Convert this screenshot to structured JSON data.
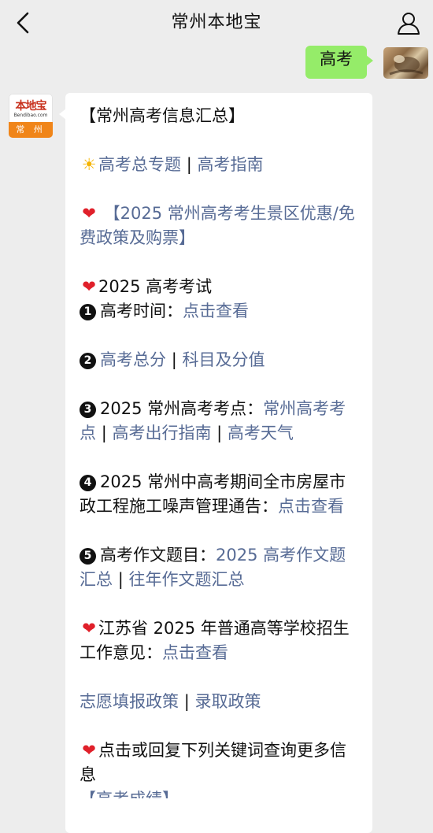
{
  "header": {
    "title": "常州本地宝"
  },
  "outgoing": {
    "text": "高考"
  },
  "logo": {
    "main": "本地宝",
    "sub": "Bendibao.com",
    "city": "常 州"
  },
  "message": {
    "heading": "【常州高考信息汇总】",
    "topic_link": "高考总专题",
    "guide_link": "高考指南",
    "scenic_link": "【2025 常州高考考生景区优惠/免费政策及购票】",
    "exam_heading": "2025 高考考试",
    "item1_label": "高考时间：",
    "item1_link": "点击查看",
    "item2_link_a": "高考总分",
    "item2_link_b": "科目及分值",
    "item3_label": "2025 常州高考考点：",
    "item3_link_a": "常州高考考点",
    "item3_link_b": "高考出行指南",
    "item3_link_c": "高考天气",
    "item4_label": "2025 常州中高考期间全市房屋市政工程施工噪声管理通告：",
    "item4_link": "点击查看",
    "item5_label": "高考作文题目：",
    "item5_link_a": "2025 高考作文题汇总",
    "item5_link_b": "往年作文题汇总",
    "jiangsu_label": "江苏省 2025 年普通高等学校招生工作意见：",
    "jiangsu_link": "点击查看",
    "zhiyuan_link": "志愿填报政策",
    "luqu_link": "录取政策",
    "query_text": "点击或回复下列关键词查询更多信息",
    "cut_text": "【高考成绩】",
    "separator": "|",
    "num1": "1",
    "num2": "2",
    "num3": "3",
    "num4": "4",
    "num5": "5",
    "sun_icon": "☀",
    "heart_icon": "❤"
  },
  "colors": {
    "link": "#576b95",
    "bubble": "#95ec69",
    "background": "#ededed"
  }
}
